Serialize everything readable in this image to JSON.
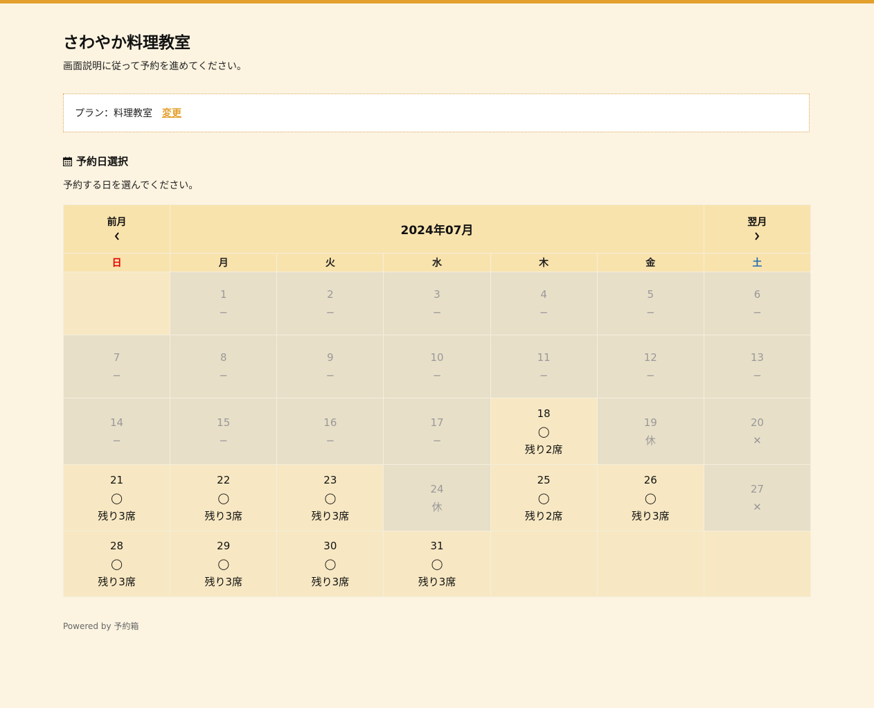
{
  "site": {
    "title": "さわやか料理教室",
    "description": "画面説明に従って予約を進めてください。"
  },
  "plan": {
    "label": "プラン：料理教室",
    "change_label": "変更"
  },
  "section": {
    "heading": "予約日選択",
    "description": "予約する日を選んでください。"
  },
  "calendar": {
    "prev_label": "前月",
    "prev_arrow": "‹",
    "month_title": "2024年07月",
    "next_label": "翌月",
    "next_arrow": "›",
    "weekdays": [
      "日",
      "月",
      "火",
      "水",
      "木",
      "金",
      "土"
    ],
    "weeks": [
      [
        {
          "day": "",
          "mark": "",
          "remain": "",
          "status": "empty"
        },
        {
          "day": "1",
          "mark": "−",
          "remain": "",
          "status": "unavailable"
        },
        {
          "day": "2",
          "mark": "−",
          "remain": "",
          "status": "unavailable"
        },
        {
          "day": "3",
          "mark": "−",
          "remain": "",
          "status": "unavailable"
        },
        {
          "day": "4",
          "mark": "−",
          "remain": "",
          "status": "unavailable"
        },
        {
          "day": "5",
          "mark": "−",
          "remain": "",
          "status": "unavailable"
        },
        {
          "day": "6",
          "mark": "−",
          "remain": "",
          "status": "unavailable"
        }
      ],
      [
        {
          "day": "7",
          "mark": "−",
          "remain": "",
          "status": "unavailable"
        },
        {
          "day": "8",
          "mark": "−",
          "remain": "",
          "status": "unavailable"
        },
        {
          "day": "9",
          "mark": "−",
          "remain": "",
          "status": "unavailable"
        },
        {
          "day": "10",
          "mark": "−",
          "remain": "",
          "status": "unavailable"
        },
        {
          "day": "11",
          "mark": "−",
          "remain": "",
          "status": "unavailable"
        },
        {
          "day": "12",
          "mark": "−",
          "remain": "",
          "status": "unavailable"
        },
        {
          "day": "13",
          "mark": "−",
          "remain": "",
          "status": "unavailable"
        }
      ],
      [
        {
          "day": "14",
          "mark": "−",
          "remain": "",
          "status": "unavailable"
        },
        {
          "day": "15",
          "mark": "−",
          "remain": "",
          "status": "unavailable"
        },
        {
          "day": "16",
          "mark": "−",
          "remain": "",
          "status": "unavailable"
        },
        {
          "day": "17",
          "mark": "−",
          "remain": "",
          "status": "unavailable"
        },
        {
          "day": "18",
          "mark": "◯",
          "remain": "残り2席",
          "status": "available"
        },
        {
          "day": "19",
          "mark": "休",
          "remain": "",
          "status": "unavailable"
        },
        {
          "day": "20",
          "mark": "✕",
          "remain": "",
          "status": "unavailable"
        }
      ],
      [
        {
          "day": "21",
          "mark": "◯",
          "remain": "残り3席",
          "status": "available"
        },
        {
          "day": "22",
          "mark": "◯",
          "remain": "残り3席",
          "status": "available"
        },
        {
          "day": "23",
          "mark": "◯",
          "remain": "残り3席",
          "status": "available"
        },
        {
          "day": "24",
          "mark": "休",
          "remain": "",
          "status": "unavailable"
        },
        {
          "day": "25",
          "mark": "◯",
          "remain": "残り2席",
          "status": "available"
        },
        {
          "day": "26",
          "mark": "◯",
          "remain": "残り3席",
          "status": "available"
        },
        {
          "day": "27",
          "mark": "✕",
          "remain": "",
          "status": "unavailable"
        }
      ],
      [
        {
          "day": "28",
          "mark": "◯",
          "remain": "残り3席",
          "status": "available"
        },
        {
          "day": "29",
          "mark": "◯",
          "remain": "残り3席",
          "status": "available"
        },
        {
          "day": "30",
          "mark": "◯",
          "remain": "残り3席",
          "status": "available"
        },
        {
          "day": "31",
          "mark": "◯",
          "remain": "残り3席",
          "status": "available"
        },
        {
          "day": "",
          "mark": "",
          "remain": "",
          "status": "empty"
        },
        {
          "day": "",
          "mark": "",
          "remain": "",
          "status": "empty"
        },
        {
          "day": "",
          "mark": "",
          "remain": "",
          "status": "empty"
        }
      ]
    ]
  },
  "footer": {
    "text": "Powered by 予約箱"
  },
  "colors": {
    "accent": "#e3a02d",
    "background": "#fcf4e1",
    "header_cell": "#f9e3ad",
    "available_cell": "#f7e8c3",
    "unavailable_cell": "#e8dfc8",
    "sunday": "#e00000",
    "saturday": "#1f6bb0"
  },
  "icons": {
    "section_icon": "calendar-icon",
    "prev_icon": "chevron-left-icon",
    "next_icon": "chevron-right-icon"
  }
}
